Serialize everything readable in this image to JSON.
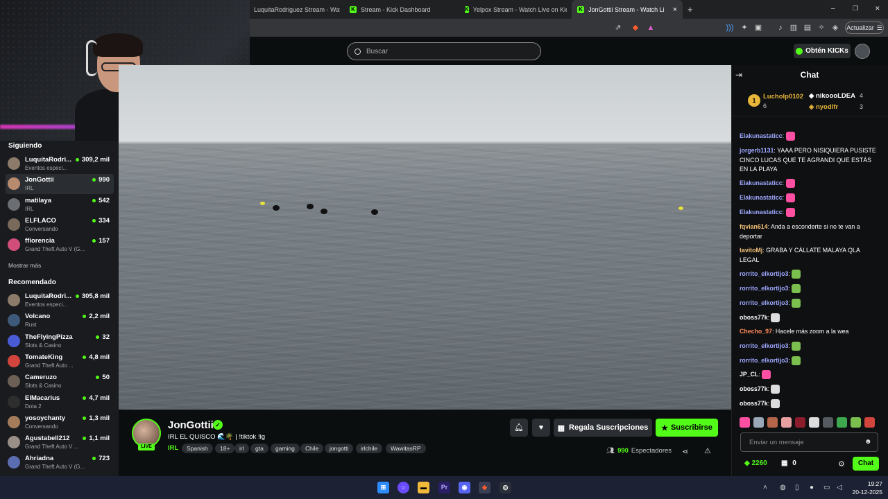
{
  "browser": {
    "tabs": [
      {
        "label": "LuquitaRodriguez Stream - Watch Live",
        "active": false
      },
      {
        "label": "Stream - Kick Dashboard",
        "active": false
      },
      {
        "label": "Yelpox Stream - Watch Live on Kick",
        "active": false
      },
      {
        "label": "JonGottii Stream - Watch Li",
        "active": true
      }
    ],
    "close_tab": "×",
    "new_tab": "+",
    "window_controls": [
      "–",
      "❐",
      "✕"
    ],
    "update_label": "Actualizar"
  },
  "header": {
    "search_placeholder": "Buscar",
    "kicks_label": "Obtén KICKs"
  },
  "sidebar": {
    "following_title": "Siguiendo",
    "following": [
      {
        "name": "LuquitaRodri...",
        "sub": "Eventos especi...",
        "viewers": "309,2 mil",
        "color": "#8c7b6a"
      },
      {
        "name": "JonGottii",
        "sub": "IRL",
        "viewers": "990",
        "color": "#b88b6e"
      },
      {
        "name": "matilaya",
        "sub": "IRL",
        "viewers": "542",
        "color": "#6b6f73"
      },
      {
        "name": "ELFLACO",
        "sub": "Conversando",
        "viewers": "334",
        "color": "#7a6a5c"
      },
      {
        "name": "ffiorencia",
        "sub": "Grand Theft Auto V (G...",
        "viewers": "157",
        "color": "#d24e7a"
      }
    ],
    "show_more": "Mostrar más",
    "recommended_title": "Recomendado",
    "recommended": [
      {
        "name": "LuquitaRodri...",
        "sub": "Eventos especi...",
        "viewers": "305,8 mil",
        "color": "#8c7b6a"
      },
      {
        "name": "Volcano",
        "sub": "Rust",
        "viewers": "2,2 mil",
        "color": "#3e5a7a"
      },
      {
        "name": "TheFlyingPizza",
        "sub": "Slots & Casino",
        "viewers": "32",
        "color": "#4a5bd6"
      },
      {
        "name": "TomateKing",
        "sub": "Grand Theft Auto ...",
        "viewers": "4,8 mil",
        "color": "#d2453c"
      },
      {
        "name": "Cameruzo",
        "sub": "Slots & Casino",
        "viewers": "50",
        "color": "#6c5f55"
      },
      {
        "name": "ElMacarius",
        "sub": "Dota 2",
        "viewers": "4,7 mil",
        "color": "#2e2e2e"
      },
      {
        "name": "yosoychanty",
        "sub": "Conversando",
        "viewers": "1,3 mil",
        "color": "#a47c5c"
      },
      {
        "name": "Agustabell212",
        "sub": "Grand Theft Auto V ...",
        "viewers": "1,1 mil",
        "color": "#9a8f86"
      },
      {
        "name": "Ahriadna",
        "sub": "Grand Theft Auto V (G...",
        "viewers": "723",
        "color": "#5a6db0"
      }
    ]
  },
  "stream": {
    "name": "JonGottii",
    "live_badge": "LIVE",
    "title": "IRL EL QUISCO 🌊🌴 | !tiktok !ig",
    "category": "IRL",
    "tags": [
      "Spanish",
      "18+",
      "irl",
      "gta",
      "gaming",
      "Chile",
      "jongotti",
      "irlchile",
      "WawitasRP"
    ],
    "gift_label": "Regala Suscripciones",
    "subscribe_label": "Suscribirse",
    "viewers_count": "990",
    "viewers_label": "Espectadores"
  },
  "chat": {
    "title": "Chat",
    "top_gifters": [
      {
        "rank": "1",
        "name": "Lucholp0102",
        "value": "6",
        "color": "#e8b63a"
      },
      {
        "name": "nikoooLDEA",
        "value": "4",
        "color": "#ffffff"
      },
      {
        "name": "nyodlfr",
        "value": "3",
        "color": "#e8b63a"
      }
    ],
    "messages": [
      {
        "user": "Elakunastaticc",
        "text": "",
        "color": "#9fa8ff",
        "emote": "#ff4fa3"
      },
      {
        "user": "jorgerb1131",
        "text": "YAAA PERO NISIQUIERA PUSISTE CINCO LUCAS QUE TE AGRANDI QUE ESTÁS EN LA PLAYA",
        "color": "#9fa8ff",
        "emote": ""
      },
      {
        "user": "Elakunastaticc",
        "text": "",
        "color": "#9fa8ff",
        "emote": "#ff4fa3"
      },
      {
        "user": "Elakunastaticc",
        "text": "",
        "color": "#9fa8ff",
        "emote": "#ff4fa3"
      },
      {
        "user": "Elakunastaticc",
        "text": "",
        "color": "#9fa8ff",
        "emote": "#ff4fa3"
      },
      {
        "user": "fqvian614",
        "text": "Anda a esconderte si no te van a deportar",
        "color": "#f5c27a",
        "emote": ""
      },
      {
        "user": "tavitoMj",
        "text": "GRABA Y CÁLLATE MALAYA QLA LEGAL",
        "color": "#f5c27a",
        "emote": ""
      },
      {
        "user": "rorrito_elkortijo3",
        "text": "",
        "color": "#9fa8ff",
        "emote": "#7bbf4f"
      },
      {
        "user": "rorrito_elkortijo3",
        "text": "",
        "color": "#9fa8ff",
        "emote": "#7bbf4f"
      },
      {
        "user": "rorrito_elkortijo3",
        "text": "",
        "color": "#9fa8ff",
        "emote": "#7bbf4f"
      },
      {
        "user": "oboss77k",
        "text": "",
        "color": "#ffffff",
        "emote": "#dddddd"
      },
      {
        "user": "Checho_97",
        "text": "Hacele más zoom a la wea",
        "color": "#ff8a5c",
        "emote": ""
      },
      {
        "user": "rorrito_elkortijo3",
        "text": "",
        "color": "#9fa8ff",
        "emote": "#7bbf4f"
      },
      {
        "user": "rorrito_elkortijo3",
        "text": "",
        "color": "#9fa8ff",
        "emote": "#7bbf4f"
      },
      {
        "user": "JP_CL",
        "text": "",
        "color": "#ffffff",
        "emote": "#ff4fa3"
      },
      {
        "user": "oboss77k",
        "text": "",
        "color": "#ffffff",
        "emote": "#dddddd"
      },
      {
        "user": "oboss77k",
        "text": "",
        "color": "#ffffff",
        "emote": "#dddddd"
      }
    ],
    "input_placeholder": "Enviar un mensaje",
    "points": "2260",
    "gift_count": "0",
    "send_label": "Chat"
  },
  "taskbar": {
    "time": "19:27",
    "date": "20-12-2025"
  },
  "colors": {
    "accent": "#53fc18",
    "background": "#0b0e0f",
    "sidebar": "#191b1f"
  }
}
